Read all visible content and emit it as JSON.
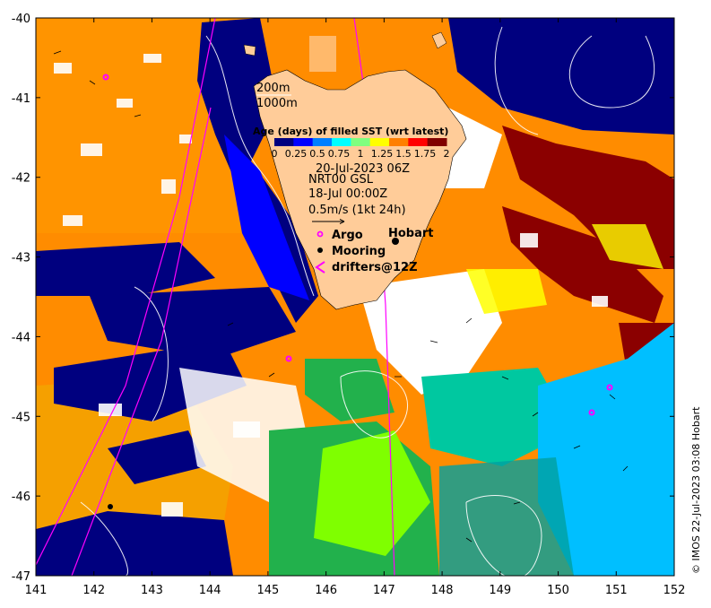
{
  "map": {
    "lon_ticks": [
      "141",
      "142",
      "143",
      "144",
      "145",
      "146",
      "147",
      "148",
      "149",
      "150",
      "151",
      "152"
    ],
    "lat_ticks": [
      "-40",
      "-41",
      "-42",
      "-43",
      "-44",
      "-45",
      "-46",
      "-47"
    ],
    "lon_range": [
      141,
      152
    ],
    "lat_range": [
      -47,
      -40
    ]
  },
  "legend": {
    "depth_200": "200m",
    "depth_1000": "1000m",
    "colorbar_title": "Age (days) of filled SST (wrt latest)",
    "colorbar_ticks": [
      "0",
      "0.25",
      "0.5",
      "0.75",
      "1",
      "1.25",
      "1.5",
      "1.75",
      "2"
    ],
    "colorbar_colors": [
      "#00007f",
      "#0000ff",
      "#007fff",
      "#00ffff",
      "#7fff7f",
      "#ffff00",
      "#ff7f00",
      "#ff0000",
      "#7f0000"
    ],
    "date": "20-Jul-2023 06Z",
    "product": "NRT00 GSL",
    "product_date": "18-Jul 00:00Z",
    "speed_scale": "0.5m/s (1kt 24h)",
    "argo_label": "Argo",
    "mooring_label": "Mooring",
    "drifters_label": "drifters@12Z",
    "city_label": "Hobart"
  },
  "credit": "© IMOS 22-Jul-2023 03:08 Hobart",
  "colors": {
    "deep_blue": "#00007f",
    "orange": "#ff8c00",
    "light_orange": "#f5a000",
    "brown": "#b06020",
    "dark_red": "#8b0000",
    "green": "#22b14c",
    "lime": "#7fff00",
    "cyan": "#00bfff",
    "yellow": "#ffff00",
    "land": "#ffcc99",
    "argo": "#ff00ff"
  }
}
